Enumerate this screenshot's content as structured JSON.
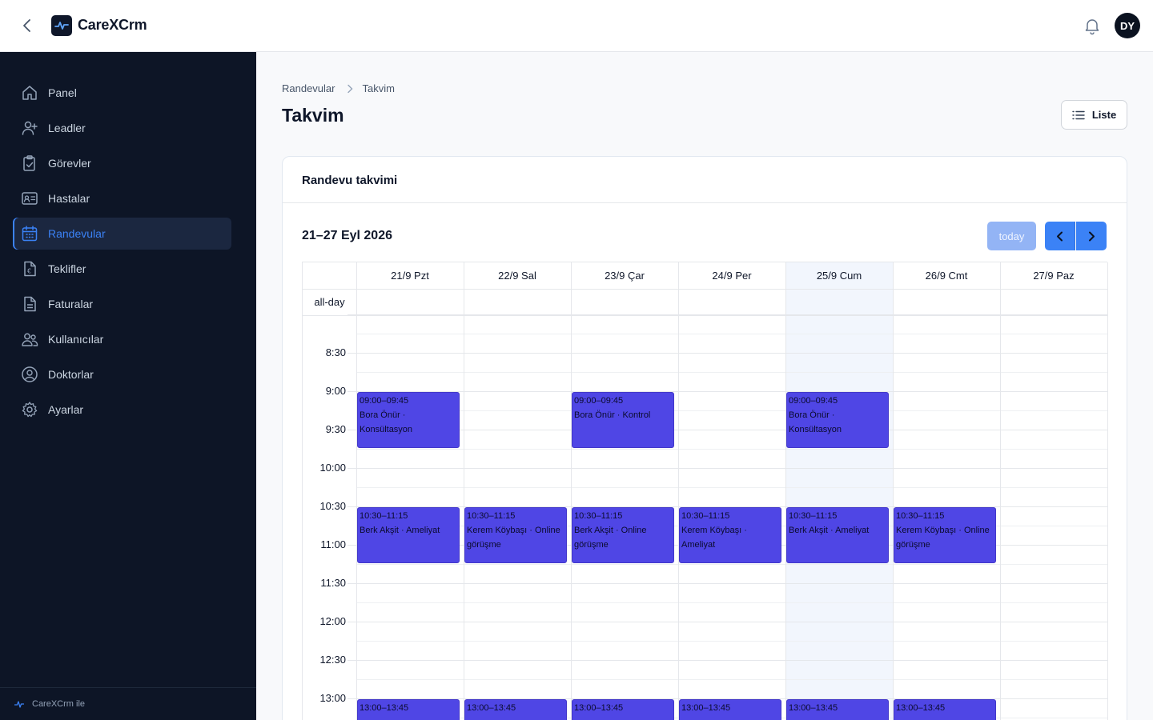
{
  "app": {
    "brand": "CareXCrm",
    "avatar_initials": "DY",
    "accent_color": "#3b82f6",
    "event_color": "#4f46e5"
  },
  "sidebar": {
    "items": [
      {
        "label": "Panel",
        "icon": "home-icon",
        "active": false
      },
      {
        "label": "Leadler",
        "icon": "user-plus-icon",
        "active": false
      },
      {
        "label": "Görevler",
        "icon": "clipboard-check-icon",
        "active": false
      },
      {
        "label": "Hastalar",
        "icon": "id-card-icon",
        "active": false
      },
      {
        "label": "Randevular",
        "icon": "calendar-icon",
        "active": true
      },
      {
        "label": "Teklifler",
        "icon": "euro-document-icon",
        "active": false
      },
      {
        "label": "Faturalar",
        "icon": "document-icon",
        "active": false
      },
      {
        "label": "Kullanıcılar",
        "icon": "users-icon",
        "active": false
      },
      {
        "label": "Doktorlar",
        "icon": "user-circle-icon",
        "active": false
      },
      {
        "label": "Ayarlar",
        "icon": "gear-icon",
        "active": false
      }
    ],
    "footer": "CareXCrm ile"
  },
  "breadcrumb": {
    "parent": "Randevular",
    "current": "Takvim"
  },
  "page": {
    "title": "Takvim",
    "list_button": "Liste"
  },
  "calendar": {
    "card_title": "Randevu takvimi",
    "range": "21–27 Eyl 2026",
    "today_label": "today",
    "allday_label": "all-day",
    "days": [
      "21/9 Pzt",
      "22/9 Sal",
      "23/9 Çar",
      "24/9 Per",
      "25/9 Cum",
      "26/9 Cmt",
      "27/9 Paz"
    ],
    "today_index": 4,
    "time_labels": [
      "8:30",
      "9:00",
      "9:30",
      "10:00",
      "10:30",
      "11:00",
      "11:30",
      "12:00",
      "12:30",
      "13:00"
    ],
    "events": [
      {
        "day": 0,
        "start": "09:00",
        "end": "09:45",
        "time": "09:00–09:45",
        "title": "Bora Önür · Konsültasyon"
      },
      {
        "day": 2,
        "start": "09:00",
        "end": "09:45",
        "time": "09:00–09:45",
        "title": "Bora Önür · Kontrol"
      },
      {
        "day": 4,
        "start": "09:00",
        "end": "09:45",
        "time": "09:00–09:45",
        "title": "Bora Önür · Konsültasyon"
      },
      {
        "day": 0,
        "start": "10:30",
        "end": "11:15",
        "time": "10:30–11:15",
        "title": "Berk Akşit · Ameliyat"
      },
      {
        "day": 1,
        "start": "10:30",
        "end": "11:15",
        "time": "10:30–11:15",
        "title": "Kerem Köybaşı · Online görüşme"
      },
      {
        "day": 2,
        "start": "10:30",
        "end": "11:15",
        "time": "10:30–11:15",
        "title": "Berk Akşit · Online görüşme"
      },
      {
        "day": 3,
        "start": "10:30",
        "end": "11:15",
        "time": "10:30–11:15",
        "title": "Kerem Köybaşı · Ameliyat"
      },
      {
        "day": 4,
        "start": "10:30",
        "end": "11:15",
        "time": "10:30–11:15",
        "title": "Berk Akşit · Ameliyat"
      },
      {
        "day": 5,
        "start": "10:30",
        "end": "11:15",
        "time": "10:30–11:15",
        "title": "Kerem Köybaşı · Online görüşme"
      },
      {
        "day": 0,
        "start": "13:00",
        "end": "13:45",
        "time": "13:00–13:45",
        "title": ""
      },
      {
        "day": 1,
        "start": "13:00",
        "end": "13:45",
        "time": "13:00–13:45",
        "title": ""
      },
      {
        "day": 2,
        "start": "13:00",
        "end": "13:45",
        "time": "13:00–13:45",
        "title": ""
      },
      {
        "day": 3,
        "start": "13:00",
        "end": "13:45",
        "time": "13:00–13:45",
        "title": ""
      },
      {
        "day": 4,
        "start": "13:00",
        "end": "13:45",
        "time": "13:00–13:45",
        "title": ""
      },
      {
        "day": 5,
        "start": "13:00",
        "end": "13:45",
        "time": "13:00–13:45",
        "title": ""
      }
    ]
  }
}
